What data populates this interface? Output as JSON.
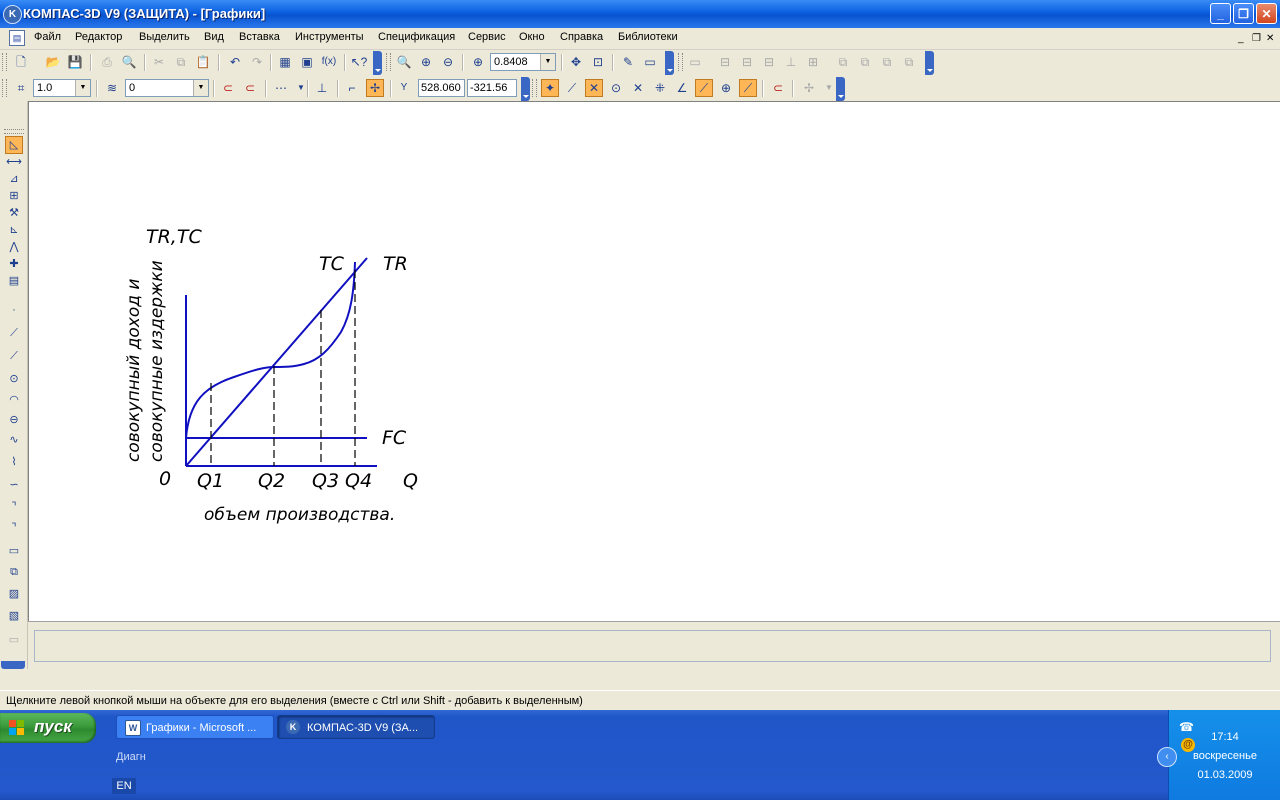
{
  "window": {
    "title": "КОМПАС-3D V9 (ЗАЩИТА) - [Графики]",
    "minimize": "_",
    "restore": "❐",
    "close": "✕"
  },
  "menu": {
    "items": [
      "Файл",
      "Редактор",
      "Выделить",
      "Вид",
      "Вставка",
      "Инструменты",
      "Спецификация",
      "Сервис",
      "Окно",
      "Справка",
      "Библиотеки"
    ],
    "mdi_minimize": "_",
    "mdi_restore": "❐",
    "mdi_close": "✕"
  },
  "toolbar_standard": {
    "zoom_value": "0.8408"
  },
  "toolbar_current": {
    "step_value": "1.0",
    "layer_value": "0",
    "coord_label": "Y",
    "coord_x": "528.060",
    "coord_y": "-321.56"
  },
  "drawing": {
    "y_axis_title": "TR,TC",
    "y_axis_label_line1": "совокупный доход и",
    "y_axis_label_line2": "совокупные издержки",
    "origin_label": "0",
    "x_axis_symbol": "Q",
    "x_axis_label": "объем производства.",
    "q_labels": [
      "Q1",
      "Q2",
      "Q3",
      "Q4"
    ],
    "curve_labels": {
      "tc": "TC",
      "tr": "TR",
      "fc": "FC"
    },
    "line_color": "#1010c0"
  },
  "status": {
    "hint": "Щелкните левой кнопкой мыши на объекте для его выделения (вместе с Ctrl или Shift - добавить к выделенным)"
  },
  "taskbar": {
    "start_label": "пуск",
    "task1_label": "Графики - Microsoft ...",
    "task1_icon_letter": "W",
    "task2_label": "КОМПАС-3D V9 (ЗА...",
    "task2_icon_letter": "K",
    "quicklaunch_label": "Диагн",
    "language": "EN",
    "tray_email_icon": "@",
    "time": "17:14",
    "day": "воскресенье",
    "date": "01.03.2009"
  }
}
